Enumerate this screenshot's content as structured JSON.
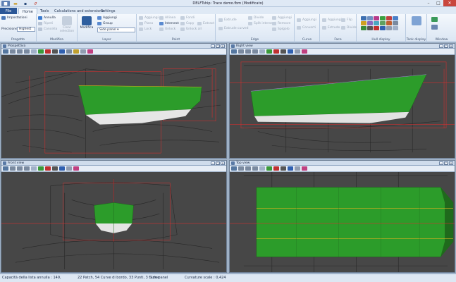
{
  "app": {
    "title": "DELFTship: Trace demo.fbm (Modificato)"
  },
  "ribbon_tabs": [
    {
      "label": "File",
      "active": false
    },
    {
      "label": "Home",
      "active": true
    },
    {
      "label": "Tools",
      "active": false
    },
    {
      "label": "Calculations and extensions",
      "active": false
    },
    {
      "label": "Settings",
      "active": false
    }
  ],
  "ribbon": {
    "progetto": {
      "group_label": "Progetto",
      "impostazioni": "Impostazioni",
      "precision_label": "Precisione",
      "precision_value": "Highest"
    },
    "modifica": {
      "group_label": "Modifica",
      "annulla": "Annulla",
      "ripeti": "Ripeti",
      "cancella": "Cancella",
      "clear_selection": "Clear selection"
    },
    "layer": {
      "group_label": "Layer",
      "modifica_btn": "Modifica",
      "aggiungi": "Aggiungi",
      "group": "Group",
      "side_panel": "Side panel"
    },
    "point": {
      "group_label": "Point",
      "aggiungi": "Aggiungi",
      "allinea": "Allinea",
      "fondi": "Fondi",
      "piano": "Piano",
      "intersect": "Intersect",
      "copy": "Copy",
      "extract": "Extract",
      "lock": "Lock",
      "unlock": "Unlock",
      "unlock_all": "Unlock all"
    },
    "edge": {
      "group_label": "Edge",
      "extrude": "Extrude",
      "extrude_curved": "Extrude curved",
      "divide": "Divide",
      "split_intersect": "Split intersect",
      "aggiungi": "Aggiungi",
      "remove": "Remove",
      "spigolo": "Spigolo"
    },
    "curve": {
      "group_label": "Curve",
      "aggiungi": "Aggiungi",
      "converti": "Converti"
    },
    "face": {
      "group_label": "Face",
      "aggiungi": "Aggiungi",
      "estrude": "Estrude",
      "flip": "Flip",
      "divide": "Divide"
    },
    "hull_display": {
      "group_label": "Hull display"
    },
    "tank_display": {
      "group_label": "Tank display"
    },
    "window": {
      "group_label": "Window"
    }
  },
  "viewports": {
    "perspective": {
      "title": "Prospettiva"
    },
    "right": {
      "title": "Right view"
    },
    "front": {
      "title": "Front view"
    },
    "top": {
      "title": "Top view"
    }
  },
  "colors": {
    "hull_green": "#2c9c2a",
    "hull_dark": "#1f6a1c",
    "guide_red": "#d03030",
    "waterline_yellow": "#d8b020",
    "background": "#464646"
  },
  "statusbar": {
    "capacity": "Capacità della lista annulla : 149,",
    "counts": "22 Patch, 54 Curve di bordo, 33 Punti, 3 Curve",
    "layer": "Side panel",
    "curvature": "Curvature scale : 0,424"
  }
}
